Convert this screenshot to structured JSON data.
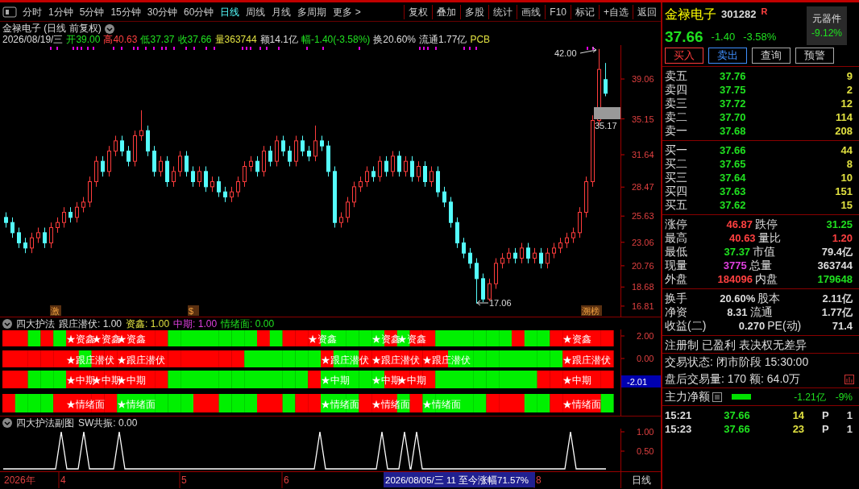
{
  "toolbar": {
    "tabs": [
      {
        "label": "分时",
        "selected": false
      },
      {
        "label": "1分钟",
        "selected": false
      },
      {
        "label": "5分钟",
        "selected": false
      },
      {
        "label": "15分钟",
        "selected": false
      },
      {
        "label": "30分钟",
        "selected": false
      },
      {
        "label": "60分钟",
        "selected": false
      },
      {
        "label": "日线",
        "selected": true
      },
      {
        "label": "周线",
        "selected": false
      },
      {
        "label": "月线",
        "selected": false
      },
      {
        "label": "多周期",
        "selected": false
      },
      {
        "label": "更多 >",
        "selected": false
      }
    ],
    "buttons": [
      "复权",
      "叠加",
      "多股",
      "统计",
      "画线",
      "F10",
      "标记",
      "+自选",
      "返回"
    ]
  },
  "chart_title": "金禄电子 (日线 前复权)",
  "quote_line": [
    {
      "text": "2026/08/19/三",
      "color": "#dddddd"
    },
    {
      "text": "开39.00",
      "color": "#20e020"
    },
    {
      "text": "高40.63",
      "color": "#ff4040"
    },
    {
      "text": "低37.37",
      "color": "#20e020"
    },
    {
      "text": "收37.66",
      "color": "#20e020"
    },
    {
      "text": "量363744",
      "color": "#e0e040"
    },
    {
      "text": "额14.1亿",
      "color": "#dddddd"
    },
    {
      "text": "幅-1.40(-3.58%)",
      "color": "#20e020"
    },
    {
      "text": "换20.60%",
      "color": "#dddddd"
    },
    {
      "text": "流通1.77亿",
      "color": "#dddddd"
    },
    {
      "text": "PCB",
      "color": "#e0e040"
    }
  ],
  "main_chart": {
    "chart_data": {
      "type": "candlestick",
      "ylim": [
        15.78,
        42.38
      ],
      "yticks": [
        39.06,
        35.15,
        31.64,
        28.47,
        25.63,
        23.06,
        20.76,
        18.68,
        16.81
      ],
      "ohlc": [
        [
          25.5,
          26,
          24.5,
          25
        ],
        [
          25,
          25.5,
          23.5,
          24
        ],
        [
          24,
          24.5,
          22.5,
          23
        ],
        [
          23,
          23.5,
          22,
          22.5
        ],
        [
          22.5,
          24,
          22,
          23.5
        ],
        [
          23.5,
          24.5,
          23,
          24
        ],
        [
          24,
          24.5,
          22.5,
          23
        ],
        [
          23,
          25,
          22.5,
          24.5
        ],
        [
          24.5,
          25.5,
          24,
          25
        ],
        [
          25,
          26.5,
          24.5,
          26
        ],
        [
          26,
          26.5,
          25,
          25.5
        ],
        [
          25.5,
          27,
          25,
          26.5
        ],
        [
          26.5,
          27.5,
          26,
          27
        ],
        [
          27,
          29.5,
          26.5,
          29
        ],
        [
          29,
          31.5,
          28.5,
          31
        ],
        [
          31,
          31.5,
          29.5,
          30
        ],
        [
          30,
          32.5,
          29.5,
          32
        ],
        [
          32,
          33.5,
          31.5,
          33
        ],
        [
          33,
          33.5,
          31.5,
          32
        ],
        [
          32,
          32.5,
          30.5,
          31
        ],
        [
          31,
          34,
          30.5,
          33.5
        ],
        [
          33.5,
          36,
          33,
          34
        ],
        [
          34,
          34.5,
          31.5,
          32
        ],
        [
          32,
          32.5,
          29.5,
          30
        ],
        [
          30,
          31.5,
          29.5,
          31
        ],
        [
          31,
          31.5,
          28.5,
          29
        ],
        [
          29,
          30.5,
          28.5,
          30
        ],
        [
          30,
          32,
          29.5,
          31.5
        ],
        [
          31.5,
          32,
          29.5,
          30
        ],
        [
          30,
          30.5,
          28.5,
          29
        ],
        [
          29,
          30.5,
          28.5,
          30
        ],
        [
          30,
          30.5,
          28,
          28.5
        ],
        [
          28.5,
          29.5,
          28,
          29
        ],
        [
          29,
          29.5,
          27.5,
          28
        ],
        [
          28,
          28.5,
          27,
          27.5
        ],
        [
          27.5,
          28.5,
          27,
          28
        ],
        [
          28,
          29.5,
          27.5,
          29
        ],
        [
          29,
          31,
          28.5,
          30.5
        ],
        [
          30.5,
          31.5,
          30,
          31
        ],
        [
          31,
          31.5,
          29.5,
          30
        ],
        [
          30,
          32.5,
          29.5,
          32
        ],
        [
          32,
          32.5,
          30.5,
          31
        ],
        [
          31,
          33.5,
          30.5,
          33
        ],
        [
          33,
          33.5,
          31.5,
          32
        ],
        [
          32,
          32.5,
          30.5,
          31
        ],
        [
          31,
          33.5,
          30.5,
          33
        ],
        [
          33,
          33.5,
          31.5,
          32
        ],
        [
          32,
          32.5,
          31,
          31.5
        ],
        [
          31.5,
          34.5,
          31,
          33
        ],
        [
          33,
          33.5,
          32,
          32.5
        ],
        [
          32.5,
          33,
          29.5,
          30
        ],
        [
          30,
          30.5,
          24.5,
          25
        ],
        [
          25,
          26,
          24.5,
          25.5
        ],
        [
          25.5,
          27.5,
          25,
          27
        ],
        [
          27,
          29,
          26.5,
          28.5
        ],
        [
          28.5,
          29.5,
          28,
          29
        ],
        [
          29,
          30.5,
          28.5,
          30
        ],
        [
          30,
          30.5,
          29,
          29.5
        ],
        [
          29.5,
          31.5,
          29,
          31
        ],
        [
          31,
          31.5,
          29.5,
          30
        ],
        [
          30,
          32,
          29.5,
          31.5
        ],
        [
          31.5,
          32,
          29.5,
          30
        ],
        [
          30,
          31.5,
          29.5,
          31
        ],
        [
          31,
          31.5,
          29,
          29.5
        ],
        [
          29.5,
          31,
          29,
          30.5
        ],
        [
          30.5,
          31,
          28.5,
          29
        ],
        [
          29,
          30.5,
          28.5,
          30
        ],
        [
          30,
          30.5,
          27.5,
          28
        ],
        [
          28,
          28.5,
          26.5,
          27
        ],
        [
          27,
          27.5,
          24.5,
          25
        ],
        [
          25,
          25.5,
          22.5,
          23
        ],
        [
          23,
          23.5,
          21.5,
          22
        ],
        [
          22,
          22.5,
          20.5,
          21
        ],
        [
          21,
          21.5,
          17.06,
          19.5
        ],
        [
          19.5,
          20,
          17.2,
          17.5
        ],
        [
          17.5,
          19.5,
          17.3,
          19
        ],
        [
          19,
          21.5,
          18.5,
          21
        ],
        [
          21,
          22,
          20.5,
          21.5
        ],
        [
          21.5,
          22.5,
          21,
          22
        ],
        [
          22,
          22.5,
          21,
          21.5
        ],
        [
          21.5,
          23,
          21,
          22.5
        ],
        [
          22.5,
          23,
          21,
          21.5
        ],
        [
          21.5,
          22.5,
          21,
          22
        ],
        [
          22,
          22.5,
          20.5,
          21
        ],
        [
          21,
          22.5,
          20.5,
          22
        ],
        [
          22,
          23,
          21.5,
          22.5
        ],
        [
          22.5,
          23.5,
          22,
          23
        ],
        [
          23,
          24,
          22.5,
          23.5
        ],
        [
          23.5,
          24.5,
          23,
          24
        ],
        [
          24,
          26.5,
          23.5,
          26
        ],
        [
          26,
          29.5,
          25.5,
          29
        ],
        [
          29,
          35.5,
          28.5,
          35
        ],
        [
          35,
          42,
          34.5,
          40
        ],
        [
          39,
          40.63,
          37.37,
          37.66
        ]
      ]
    },
    "high_label": "42.00",
    "low_label": "17.06",
    "last_label": "35.17",
    "tags": [
      {
        "text": "激"
      },
      {
        "text": "$"
      },
      {
        "text": "溯榜"
      }
    ]
  },
  "indicator": {
    "title": "四大护法",
    "legend": [
      {
        "text": "跟庄潜伏: 1.00",
        "color": "#dddddd"
      },
      {
        "text": "资鑫: 1.00",
        "color": "#e0e040"
      },
      {
        "text": "中期: 1.00",
        "color": "#e040e0"
      },
      {
        "text": "情绪面: 0.00",
        "color": "#20e020"
      }
    ],
    "ticks": [
      "2.00",
      "0.00"
    ],
    "current": "-2.01",
    "strips": [
      {
        "cells": [
          {
            "color": "#ff0000"
          },
          {
            "color": "#ff0000"
          },
          {
            "color": "#00f000"
          },
          {
            "color": "#ff0000"
          },
          {
            "color": "#00f000"
          },
          {
            "color": "#ff0000",
            "label": "★资鑫"
          },
          {
            "color": "#ff0000"
          },
          {
            "color": "#ff0000",
            "label": "★资鑫"
          },
          {
            "color": "#ff0000"
          },
          {
            "color": "#ff0000",
            "label": "★资鑫"
          },
          {
            "color": "#ff0000"
          },
          {
            "color": "#ff0000"
          },
          {
            "color": "#ff0000"
          },
          {
            "color": "#00f000"
          },
          {
            "color": "#00f000"
          },
          {
            "color": "#00f000"
          },
          {
            "color": "#00f000"
          },
          {
            "color": "#00f000"
          },
          {
            "color": "#00f000"
          },
          {
            "color": "#00f000"
          },
          {
            "color": "#ff0000"
          },
          {
            "color": "#00f000"
          },
          {
            "color": "#ff0000"
          },
          {
            "color": "#ff0000"
          },
          {
            "color": "#ff0000",
            "label": "★资鑫"
          },
          {
            "color": "#00f000"
          },
          {
            "color": "#00f000"
          },
          {
            "color": "#00f000"
          },
          {
            "color": "#00f000"
          },
          {
            "color": "#00f000",
            "label": "★资鑫"
          },
          {
            "color": "#ff0000"
          },
          {
            "color": "#00f000",
            "label": "★资鑫"
          },
          {
            "color": "#ff0000"
          },
          {
            "color": "#ff0000"
          },
          {
            "color": "#00f000"
          },
          {
            "color": "#00f000"
          },
          {
            "color": "#00f000"
          },
          {
            "color": "#00f000"
          },
          {
            "color": "#00f000"
          },
          {
            "color": "#00f000"
          },
          {
            "color": "#ff0000"
          },
          {
            "color": "#00f000"
          },
          {
            "color": "#00f000"
          },
          {
            "color": "#ff0000"
          },
          {
            "color": "#ff0000",
            "label": "★资鑫"
          },
          {
            "color": "#ff0000"
          },
          {
            "color": "#ff0000"
          },
          {
            "color": "#ff0000"
          }
        ]
      },
      {
        "cells": [
          {
            "color": "#ff0000"
          },
          {
            "color": "#ff0000"
          },
          {
            "color": "#ff0000"
          },
          {
            "color": "#ff0000"
          },
          {
            "color": "#ff0000"
          },
          {
            "color": "#ff0000",
            "label": "★跟庄潜伏"
          },
          {
            "color": "#00f000"
          },
          {
            "color": "#ff0000"
          },
          {
            "color": "#ff0000"
          },
          {
            "color": "#ff0000",
            "label": "★跟庄潜伏"
          },
          {
            "color": "#ff0000"
          },
          {
            "color": "#ff0000"
          },
          {
            "color": "#ff0000"
          },
          {
            "color": "#ff0000"
          },
          {
            "color": "#ff0000"
          },
          {
            "color": "#ff0000"
          },
          {
            "color": "#ff0000"
          },
          {
            "color": "#ff0000"
          },
          {
            "color": "#ff0000"
          },
          {
            "color": "#00f000"
          },
          {
            "color": "#00f000"
          },
          {
            "color": "#00f000"
          },
          {
            "color": "#00f000"
          },
          {
            "color": "#00f000"
          },
          {
            "color": "#00f000"
          },
          {
            "color": "#ff0000",
            "label": "★跟庄潜伏"
          },
          {
            "color": "#00f000"
          },
          {
            "color": "#00f000"
          },
          {
            "color": "#ff0000"
          },
          {
            "color": "#ff0000",
            "label": "★跟庄潜伏"
          },
          {
            "color": "#ff0000"
          },
          {
            "color": "#ff0000"
          },
          {
            "color": "#ff0000"
          },
          {
            "color": "#ff0000",
            "label": "★跟庄潜伏"
          },
          {
            "color": "#ff0000"
          },
          {
            "color": "#00f000"
          },
          {
            "color": "#00f000"
          },
          {
            "color": "#00f000"
          },
          {
            "color": "#00f000"
          },
          {
            "color": "#00f000"
          },
          {
            "color": "#00f000"
          },
          {
            "color": "#00f000"
          },
          {
            "color": "#00f000"
          },
          {
            "color": "#00f000"
          },
          {
            "color": "#ff0000",
            "label": "★跟庄潜伏"
          },
          {
            "color": "#ff0000"
          },
          {
            "color": "#ff0000"
          },
          {
            "color": "#ff0000"
          }
        ]
      },
      {
        "cells": [
          {
            "color": "#ff0000"
          },
          {
            "color": "#ff0000"
          },
          {
            "color": "#00f000"
          },
          {
            "color": "#00f000"
          },
          {
            "color": "#00f000"
          },
          {
            "color": "#ff0000",
            "label": "★中期"
          },
          {
            "color": "#ff0000"
          },
          {
            "color": "#ff0000",
            "label": "★中期"
          },
          {
            "color": "#ff0000"
          },
          {
            "color": "#ff0000",
            "label": "★中期"
          },
          {
            "color": "#ff0000"
          },
          {
            "color": "#ff0000"
          },
          {
            "color": "#ff0000"
          },
          {
            "color": "#00f000"
          },
          {
            "color": "#00f000"
          },
          {
            "color": "#00f000"
          },
          {
            "color": "#00f000"
          },
          {
            "color": "#00f000"
          },
          {
            "color": "#00f000"
          },
          {
            "color": "#00f000"
          },
          {
            "color": "#00f000"
          },
          {
            "color": "#00f000"
          },
          {
            "color": "#00f000"
          },
          {
            "color": "#00f000"
          },
          {
            "color": "#ff0000"
          },
          {
            "color": "#00f000",
            "label": "★中期"
          },
          {
            "color": "#00f000"
          },
          {
            "color": "#00f000"
          },
          {
            "color": "#00f000"
          },
          {
            "color": "#00f000",
            "label": "★中期"
          },
          {
            "color": "#ff0000"
          },
          {
            "color": "#ff0000",
            "label": "★中期"
          },
          {
            "color": "#ff0000"
          },
          {
            "color": "#ff0000"
          },
          {
            "color": "#00f000"
          },
          {
            "color": "#00f000"
          },
          {
            "color": "#00f000"
          },
          {
            "color": "#00f000"
          },
          {
            "color": "#00f000"
          },
          {
            "color": "#00f000"
          },
          {
            "color": "#00f000"
          },
          {
            "color": "#00f000"
          },
          {
            "color": "#ff0000"
          },
          {
            "color": "#ff0000"
          },
          {
            "color": "#ff0000",
            "label": "★中期"
          },
          {
            "color": "#ff0000"
          },
          {
            "color": "#ff0000"
          },
          {
            "color": "#ff0000"
          }
        ]
      },
      {
        "cells": [
          {
            "color": "#ff0000"
          },
          {
            "color": "#00f000"
          },
          {
            "color": "#00f000"
          },
          {
            "color": "#00f000"
          },
          {
            "color": "#ff0000"
          },
          {
            "color": "#ff0000",
            "label": "★情绪面"
          },
          {
            "color": "#ff0000"
          },
          {
            "color": "#ff0000"
          },
          {
            "color": "#ff0000"
          },
          {
            "color": "#00f000",
            "label": "★情绪面"
          },
          {
            "color": "#00f000"
          },
          {
            "color": "#00f000"
          },
          {
            "color": "#00f000"
          },
          {
            "color": "#00f000"
          },
          {
            "color": "#00f000"
          },
          {
            "color": "#ff0000"
          },
          {
            "color": "#ff0000"
          },
          {
            "color": "#00f000"
          },
          {
            "color": "#00f000"
          },
          {
            "color": "#00f000"
          },
          {
            "color": "#ff0000"
          },
          {
            "color": "#ff0000"
          },
          {
            "color": "#00f000"
          },
          {
            "color": "#ff0000"
          },
          {
            "color": "#ff0000"
          },
          {
            "color": "#00f000",
            "label": "★情绪面"
          },
          {
            "color": "#00f000"
          },
          {
            "color": "#00f000"
          },
          {
            "color": "#ff0000"
          },
          {
            "color": "#ff0000",
            "label": "★情绪面"
          },
          {
            "color": "#ff0000"
          },
          {
            "color": "#00f000"
          },
          {
            "color": "#ff0000"
          },
          {
            "color": "#00f000",
            "label": "★情绪面"
          },
          {
            "color": "#00f000"
          },
          {
            "color": "#00f000"
          },
          {
            "color": "#00f000"
          },
          {
            "color": "#00f000"
          },
          {
            "color": "#ff0000"
          },
          {
            "color": "#ff0000"
          },
          {
            "color": "#ff0000"
          },
          {
            "color": "#00f000"
          },
          {
            "color": "#00f000"
          },
          {
            "color": "#ff0000"
          },
          {
            "color": "#ff0000",
            "label": "★情绪面"
          },
          {
            "color": "#ff0000"
          },
          {
            "color": "#ff0000"
          },
          {
            "color": "#00f000"
          }
        ]
      }
    ]
  },
  "sub_indicator": {
    "title": "四大护法副图",
    "legend": "SW共振: 0.00",
    "ticks": [
      "1.00",
      "0.50"
    ]
  },
  "time_axis": {
    "labels": [
      "2026年",
      "4",
      "5",
      "6",
      "8"
    ],
    "tooltip": "2026/08/05/三 11 至今涨幅71.57%",
    "period": "日线"
  },
  "quote_panel": {
    "name": "金禄电子",
    "code": "301282",
    "badge": "R",
    "sector": "元器件",
    "sector_change": "-9.12%",
    "price": "37.66",
    "change": "-1.40",
    "change_pct": "-3.58%",
    "actions": [
      {
        "label": "买入",
        "kind": "buy"
      },
      {
        "label": "卖出",
        "kind": "sell"
      },
      {
        "label": "查询",
        "kind": "plain"
      },
      {
        "label": "预警",
        "kind": "plain"
      }
    ],
    "asks": [
      {
        "label": "卖五",
        "price": "37.76",
        "volume": "9"
      },
      {
        "label": "卖四",
        "price": "37.75",
        "volume": "2"
      },
      {
        "label": "卖三",
        "price": "37.72",
        "volume": "12"
      },
      {
        "label": "卖二",
        "price": "37.70",
        "volume": "114"
      },
      {
        "label": "卖一",
        "price": "37.68",
        "volume": "208"
      }
    ],
    "bids": [
      {
        "label": "买一",
        "price": "37.66",
        "volume": "44"
      },
      {
        "label": "买二",
        "price": "37.65",
        "volume": "8"
      },
      {
        "label": "买三",
        "price": "37.64",
        "volume": "10"
      },
      {
        "label": "买四",
        "price": "37.63",
        "volume": "151"
      },
      {
        "label": "买五",
        "price": "37.62",
        "volume": "15"
      }
    ],
    "stats": [
      [
        {
          "label": "涨停",
          "value": "46.87",
          "color": "#ff4040"
        },
        {
          "label": "跌停",
          "value": "31.25",
          "color": "#20e020"
        }
      ],
      [
        {
          "label": "最高",
          "value": "40.63",
          "color": "#ff4040"
        },
        {
          "label": "量比",
          "value": "1.20",
          "color": "#ff4040"
        }
      ],
      [
        {
          "label": "最低",
          "value": "37.37",
          "color": "#20e020"
        },
        {
          "label": "市值",
          "value": "79.4亿",
          "color": "#dddddd"
        }
      ],
      [
        {
          "label": "现量",
          "value": "3775",
          "color": "#e040e0"
        },
        {
          "label": "总量",
          "value": "363744",
          "color": "#dddddd"
        }
      ],
      [
        {
          "label": "外盘",
          "value": "184096",
          "color": "#ff4040"
        },
        {
          "label": "内盘",
          "value": "179648",
          "color": "#20e020"
        }
      ]
    ],
    "fundamentals": [
      [
        {
          "label": "换手",
          "value": "20.60%"
        },
        {
          "label": "股本",
          "value": "2.11亿"
        }
      ],
      [
        {
          "label": "净资",
          "value": "8.31"
        },
        {
          "label": "流通",
          "value": "1.77亿"
        }
      ],
      [
        {
          "label": "收益(二)",
          "value": "0.270"
        },
        {
          "label": "PE(动)",
          "value": "71.4"
        }
      ]
    ],
    "tags": "注册制 已盈利 表决权无差异",
    "status_line": "交易状态: 闭市阶段 15:30:00",
    "after_hours": "盘后交易量: 170 额: 64.0万",
    "main_flow": {
      "label": "主力净额",
      "value": "-1.21亿",
      "pct": "-9%"
    },
    "trades": [
      {
        "time": "15:21",
        "price": "37.66",
        "volume": "14",
        "side": "P",
        "count": "1"
      },
      {
        "time": "15:23",
        "price": "37.66",
        "volume": "23",
        "side": "P",
        "count": "1"
      }
    ]
  }
}
